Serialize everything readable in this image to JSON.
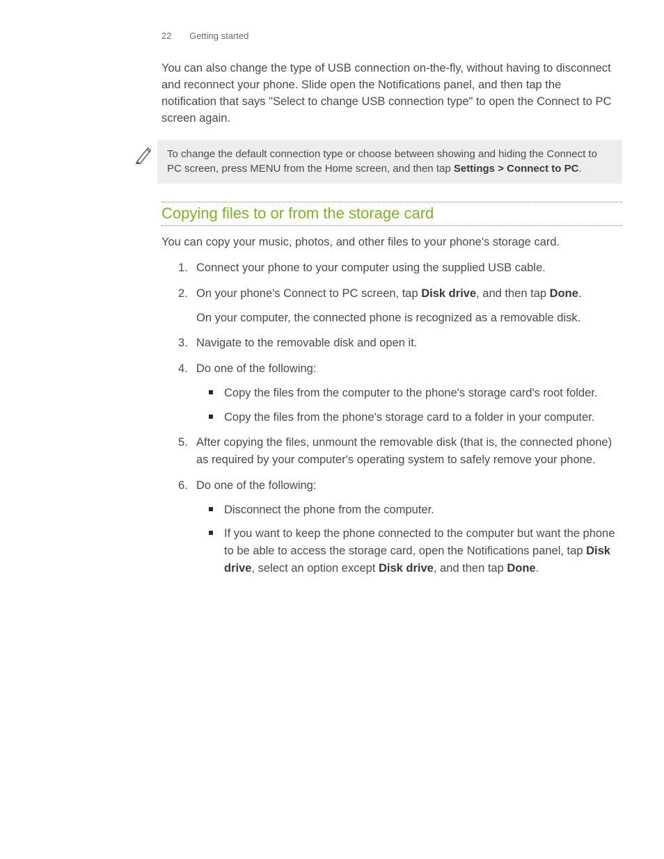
{
  "header": {
    "page_number": "22",
    "chapter": "Getting started"
  },
  "intro_paragraph": "You can also change the type of USB connection on-the-fly, without having to disconnect and reconnect your phone. Slide open the Notifications panel, and then tap the notification that says \"Select to change USB connection type\" to open the Connect to PC screen again.",
  "note": {
    "text_before": "To change the default connection type or choose between showing and hiding the Connect to PC screen, press MENU from the Home screen, and then tap ",
    "bold_path": "Settings > Connect to PC",
    "text_after": "."
  },
  "section_title": "Copying files to or from the storage card",
  "section_intro": "You can copy your music, photos, and other files to your phone's storage card.",
  "steps": {
    "s1": "Connect your phone to your computer using the supplied USB cable.",
    "s2_a": "On your phone's Connect to PC screen, tap ",
    "s2_b1": "Disk drive",
    "s2_c": ", and then tap ",
    "s2_b2": "Done",
    "s2_d": ".",
    "s2_sub": "On your computer, the connected phone is recognized as a removable disk.",
    "s3": "Navigate to the removable disk and open it.",
    "s4": "Do one of the following:",
    "s4_bullets": {
      "b1": "Copy the files from the computer to the phone's storage card's root folder.",
      "b2": "Copy the files from the phone's storage card to a folder in your computer."
    },
    "s5": "After copying the files, unmount the removable disk (that is, the connected phone) as required by your computer's operating system to safely remove your phone.",
    "s6": "Do one of the following:",
    "s6_bullets": {
      "b1": "Disconnect the phone from the computer.",
      "b2_a": "If you want to keep the phone connected to the computer but want the phone to be able to access the storage card, open the Notifications panel, tap ",
      "b2_b1": "Disk drive",
      "b2_c": ", select an option except ",
      "b2_b2": "Disk drive",
      "b2_d": ", and then tap ",
      "b2_b3": "Done",
      "b2_e": "."
    }
  }
}
